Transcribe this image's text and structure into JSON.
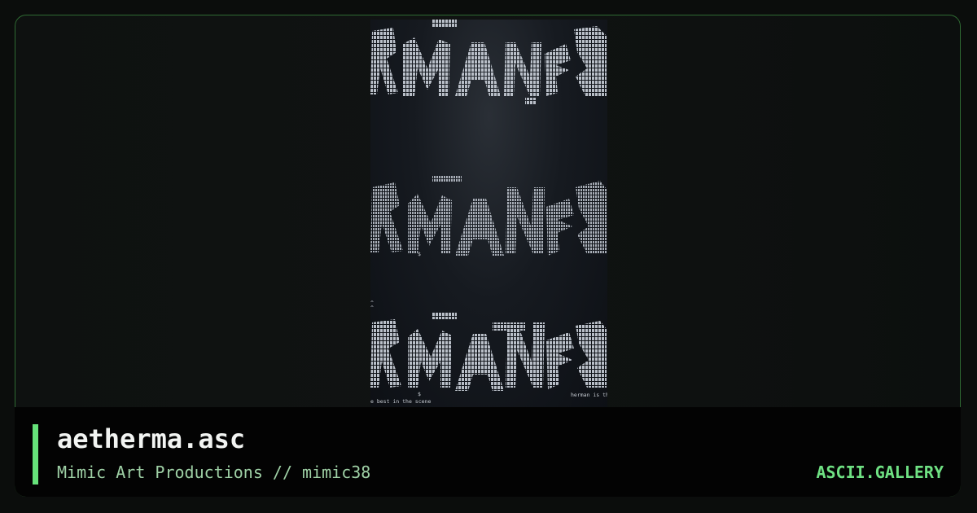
{
  "artwork": {
    "filename": "aetherma.asc",
    "credit": "Mimic Art Productions // mimic38",
    "inline_text_left": "e best in the scene",
    "inline_text_right": "herman is th",
    "art_color": "#c7ccd3"
  },
  "brand": {
    "label": "ASCII.GALLERY",
    "color": "#6fe183"
  },
  "theme": {
    "accent": "#66e27a",
    "border": "#2f6a33",
    "background": "#0b0d0c"
  }
}
